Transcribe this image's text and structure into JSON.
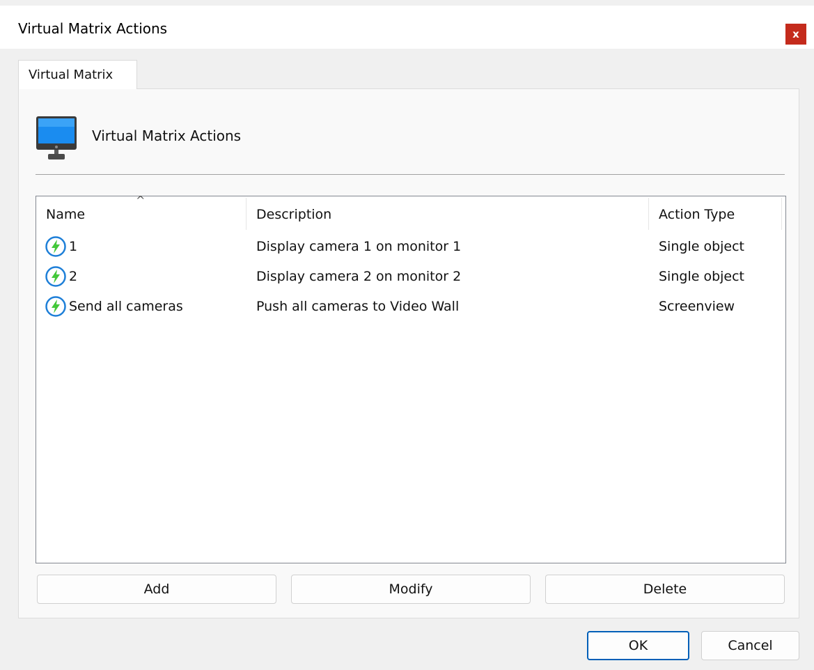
{
  "window": {
    "title": "Virtual Matrix Actions",
    "close_label": "x"
  },
  "tabs": [
    {
      "label": "Virtual Matrix"
    }
  ],
  "header": {
    "icon": "monitor-icon",
    "text": "Virtual Matrix Actions"
  },
  "list": {
    "columns": [
      "Name",
      "Description",
      "Action Type"
    ],
    "sort_indicator": "^",
    "rows": [
      {
        "icon": "action-lightning-icon",
        "name": "1",
        "description": "Display camera 1 on monitor 1",
        "action_type": "Single object"
      },
      {
        "icon": "action-lightning-icon",
        "name": "2",
        "description": "Display camera 2 on monitor 2",
        "action_type": "Single object"
      },
      {
        "icon": "action-lightning-icon",
        "name": "Send all cameras",
        "description": "Push all cameras to Video Wall",
        "action_type": "Screenview"
      }
    ]
  },
  "list_buttons": {
    "add": "Add",
    "modify": "Modify",
    "delete": "Delete"
  },
  "dialog_buttons": {
    "ok": "OK",
    "cancel": "Cancel"
  },
  "colors": {
    "close_button": "#c42b1c",
    "primary_border": "#005fb8",
    "icon_ring": "#1e7fd8",
    "icon_bolt": "#43c83a"
  }
}
